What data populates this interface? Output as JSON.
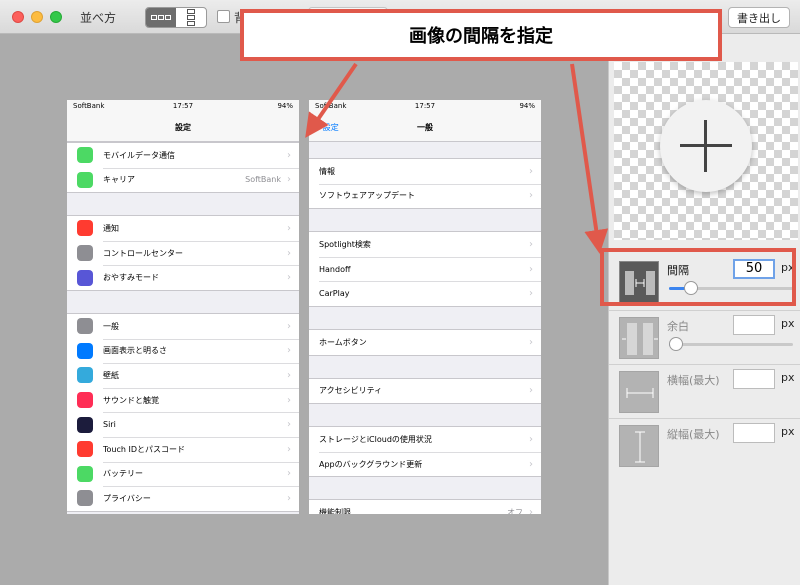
{
  "window": {
    "title": "並べ方"
  },
  "toolbar": {
    "checkbox_label": "背",
    "export_label": "書き出し"
  },
  "callout": {
    "text": "画像の間隔を指定"
  },
  "phone_left": {
    "status": {
      "carrier": "SoftBank",
      "time": "17:57",
      "battery": "94%"
    },
    "nav_title": "設定",
    "groups": [
      [
        {
          "label": "モバイルデータ通信",
          "value": "",
          "color": "#4cd964"
        },
        {
          "label": "キャリア",
          "value": "SoftBank",
          "color": "#4cd964"
        }
      ],
      [
        {
          "label": "通知",
          "value": "",
          "color": "#ff3b30"
        },
        {
          "label": "コントロールセンター",
          "value": "",
          "color": "#8e8e93"
        },
        {
          "label": "おやすみモード",
          "value": "",
          "color": "#5856d6"
        }
      ],
      [
        {
          "label": "一般",
          "value": "",
          "color": "#8e8e93"
        },
        {
          "label": "画面表示と明るさ",
          "value": "",
          "color": "#007aff"
        },
        {
          "label": "壁紙",
          "value": "",
          "color": "#34aadc"
        },
        {
          "label": "サウンドと触覚",
          "value": "",
          "color": "#ff2d55"
        },
        {
          "label": "Siri",
          "value": "",
          "color": "#1c1c3c"
        },
        {
          "label": "Touch IDとパスコード",
          "value": "",
          "color": "#ff3b30"
        },
        {
          "label": "バッテリー",
          "value": "",
          "color": "#4cd964"
        },
        {
          "label": "プライバシー",
          "value": "",
          "color": "#8e8e93"
        }
      ]
    ]
  },
  "phone_right": {
    "status": {
      "carrier": "SoftBank",
      "time": "17:57",
      "battery": "94%"
    },
    "back_label": "設定",
    "nav_title": "一般",
    "groups": [
      [
        {
          "label": "情報",
          "value": ""
        },
        {
          "label": "ソフトウェアアップデート",
          "value": ""
        }
      ],
      [
        {
          "label": "Spotlight検索",
          "value": ""
        },
        {
          "label": "Handoff",
          "value": ""
        },
        {
          "label": "CarPlay",
          "value": ""
        }
      ],
      [
        {
          "label": "ホームボタン",
          "value": ""
        }
      ],
      [
        {
          "label": "アクセシビリティ",
          "value": ""
        }
      ],
      [
        {
          "label": "ストレージとiCloudの使用状況",
          "value": ""
        },
        {
          "label": "Appのバックグラウンド更新",
          "value": ""
        }
      ],
      [
        {
          "label": "機能制限",
          "value": "オフ"
        }
      ]
    ]
  },
  "panel": {
    "spacing": {
      "label": "間隔",
      "value": "50",
      "unit": "px",
      "slider_fraction": 0.14
    },
    "margin": {
      "label": "余白",
      "value": "",
      "unit": "px",
      "slider_fraction": 0.0
    },
    "max_width": {
      "label": "横幅(最大)",
      "value": "",
      "unit": "px"
    },
    "max_height": {
      "label": "縦幅(最大)",
      "value": "",
      "unit": "px"
    }
  },
  "colors": {
    "accent": "#e0594b",
    "ios_blue": "#007aff",
    "slider_blue": "#3b84ef"
  }
}
